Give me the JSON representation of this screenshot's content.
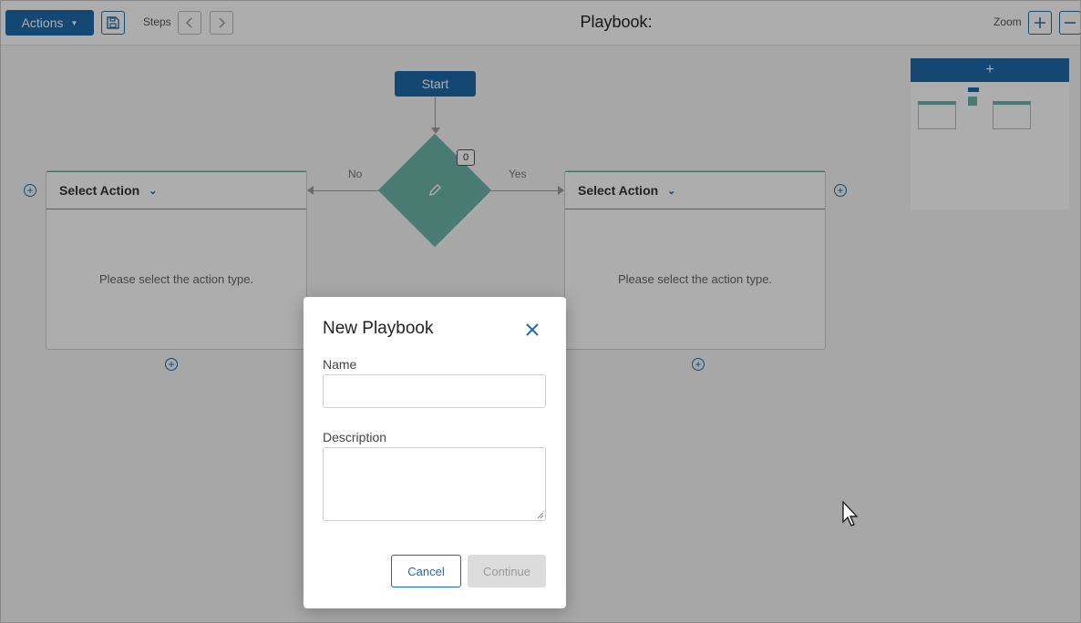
{
  "toolbar": {
    "actions_label": "Actions",
    "steps_label": "Steps",
    "title": "Playbook:",
    "zoom_label": "Zoom",
    "icons": [
      "save-icon",
      "chevron-left-icon",
      "chevron-right-icon",
      "zoom-in-icon",
      "zoom-out-icon"
    ]
  },
  "flow": {
    "start_label": "Start",
    "decision_badge": "0",
    "no_label": "No",
    "yes_label": "Yes",
    "left_card": {
      "header": "Select Action",
      "body": "Please select the action type."
    },
    "right_card": {
      "header": "Select Action",
      "body": "Please select the action type."
    }
  },
  "minimap": {
    "add_label": "+"
  },
  "modal": {
    "title": "New Playbook",
    "name_label": "Name",
    "name_value": "",
    "description_label": "Description",
    "description_value": "",
    "cancel_label": "Cancel",
    "continue_label": "Continue"
  },
  "colors": {
    "primary": "#1e6aa8",
    "decision": "#6cb5aa",
    "disabled": "#dcdcdc"
  }
}
